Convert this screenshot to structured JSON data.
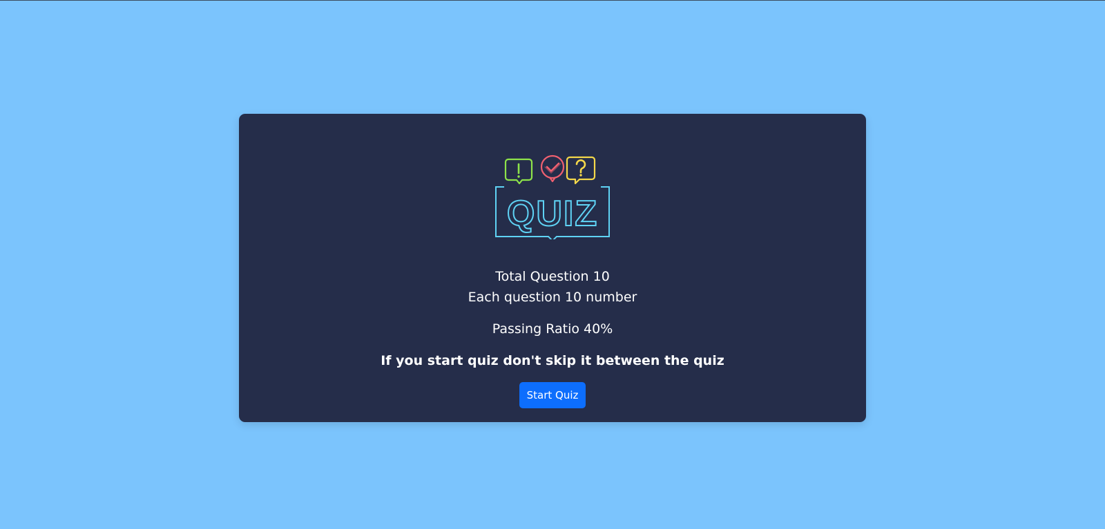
{
  "logo": {
    "text": "QUIZ",
    "icon_names": [
      "exclamation-bubble-icon",
      "check-bubble-icon",
      "question-bubble-icon"
    ],
    "colors": {
      "frame": "#5fd3f5",
      "exclamation": "#8ee44a",
      "check": "#f06070",
      "question": "#f5d94a"
    }
  },
  "info": {
    "total_questions": "Total Question 10",
    "points_each": "Each question 10 number",
    "passing_ratio": "Passing Ratio 40%",
    "warning": "If you start quiz don't skip it between the quiz"
  },
  "start_button": {
    "label": "Start Quiz",
    "color": "#0d6efd"
  },
  "theme": {
    "background": "#7bc4fd",
    "card": "#252d4a"
  }
}
